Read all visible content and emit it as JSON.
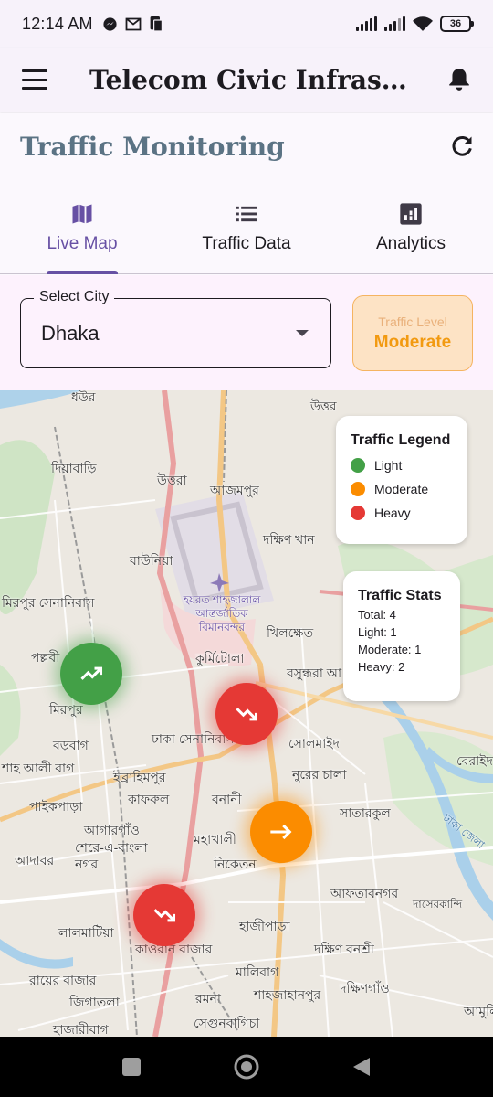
{
  "status_bar": {
    "time": "12:14 AM",
    "icons_left": [
      "messenger-icon",
      "gmail-icon",
      "sim-toolkit-icon"
    ],
    "icons_right": [
      "signal-icon",
      "signal-icon",
      "wifi-icon",
      "battery-icon"
    ],
    "battery": "36"
  },
  "app_bar": {
    "title": "Telecom Civic Infrastr...",
    "menu_icon": "menu-icon",
    "bell_icon": "bell-icon"
  },
  "page": {
    "title": "Traffic Monitoring",
    "refresh_icon": "refresh-icon"
  },
  "tabs": [
    {
      "label": "Live Map",
      "icon": "map-icon",
      "active": true
    },
    {
      "label": "Traffic Data",
      "icon": "list-icon",
      "active": false
    },
    {
      "label": "Analytics",
      "icon": "analytics-icon",
      "active": false
    }
  ],
  "city_select": {
    "label": "Select City",
    "value": "Dhaka"
  },
  "traffic_level": {
    "caption": "Traffic Level",
    "value": "Moderate"
  },
  "map": {
    "places": [
      "ধউর",
      "দিয়াবাড়ি",
      "উত্তরা",
      "আজমপুর",
      "উত্তর",
      "দক্ষিণ খান",
      "বাউনিয়া",
      "মিরপুর সেনানিবাস",
      "হযরত শাহজালাল আন্তর্জাতিক বিমানবন্দর",
      "খিলক্ষেত",
      "পল্লবী",
      "কুর্মিটোলা",
      "বসুন্ধরা আ",
      "মিরপুর",
      "ঢাকা সেনানিবাস",
      "সোলমাইদ",
      "বড়বাগ",
      "শাহ আলী বাগ",
      "ইব্রাহিমপুর",
      "নুরের চালা",
      "বেরাইদ",
      "কাফরুল",
      "বনানী",
      "সাতারকুল",
      "পাইকপাড়া",
      "আগারগাঁও",
      "শেরে-এ-বাংলা নগর",
      "মহাখালী",
      "নিকেতন",
      "আদাবর",
      "আফতাবনগর",
      "দাসেরকান্দি",
      "লালমাটিয়া",
      "হাজীপাড়া",
      "কাওরান বাজার",
      "দক্ষিণ বনশ্রী",
      "রায়ের বাজার",
      "মালিবাগ",
      "জিগাতলা",
      "রমনা",
      "শাহজাহানপুর",
      "দক্ষিণগাঁও",
      "হাজারীবাগ",
      "সেগুনবাগিচা",
      "আমুলিয়া",
      "ঢাকা জেলা"
    ],
    "legend": {
      "title": "Traffic Legend",
      "items": [
        {
          "label": "Light",
          "color": "#43a047"
        },
        {
          "label": "Moderate",
          "color": "#fb8c00"
        },
        {
          "label": "Heavy",
          "color": "#e53935"
        }
      ]
    },
    "stats": {
      "title": "Traffic Stats",
      "lines": [
        "Total: 4",
        "Light: 1",
        "Moderate: 1",
        "Heavy: 2"
      ]
    },
    "markers": [
      {
        "level": "Light",
        "icon": "trending-up-icon",
        "color": "#43a047"
      },
      {
        "level": "Heavy",
        "icon": "trending-down-icon",
        "color": "#e53935"
      },
      {
        "level": "Moderate",
        "icon": "arrow-right-icon",
        "color": "#fb8c00"
      },
      {
        "level": "Heavy",
        "icon": "trending-down-icon",
        "color": "#e53935"
      }
    ]
  },
  "nav_bar": {
    "buttons": [
      "recents-button",
      "home-button",
      "back-button"
    ]
  }
}
